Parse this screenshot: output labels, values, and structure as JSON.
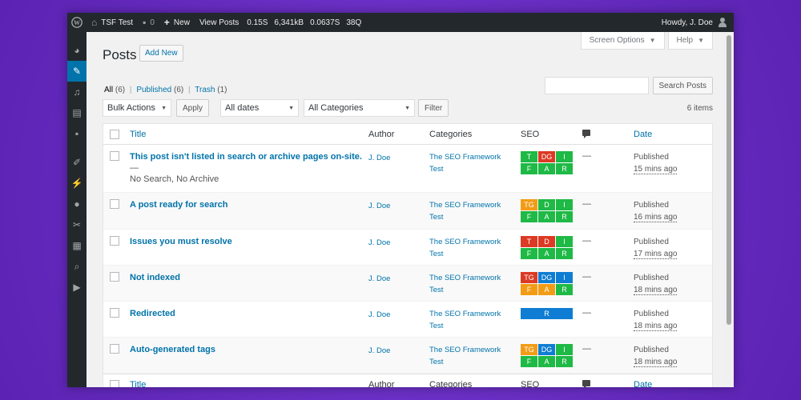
{
  "colors": {
    "seo_green": "#1fb946",
    "seo_red": "#dc3a24",
    "seo_orange": "#f29c16",
    "seo_blue": "#0e7dd3",
    "wp_blue": "#0073aa",
    "admin_bar": "#23282d"
  },
  "adminbar": {
    "site_name": "TSF Test",
    "comments_count": "0",
    "new_label": "New",
    "view_posts": "View Posts",
    "stat_time": "0.15S",
    "stat_memory": "6,341kB",
    "stat_db_time": "0.0637S",
    "stat_queries": "38Q",
    "greeting": "Howdy, J. Doe"
  },
  "sidemenu": {
    "icons": [
      "dashboard-icon",
      "posts-pin-icon",
      "media-icon",
      "pages-icon",
      "comments-icon",
      "appearance-icon",
      "plugins-icon",
      "users-icon",
      "tools-icon",
      "settings-icon",
      "seo-search-icon",
      "play-icon"
    ]
  },
  "screen_meta": {
    "screen_options": "Screen Options",
    "help": "Help"
  },
  "page": {
    "title": "Posts",
    "add_new": "Add New"
  },
  "filters": {
    "all": "All",
    "all_count": "(6)",
    "published": "Published",
    "published_count": "(6)",
    "trash": "Trash",
    "trash_count": "(1)",
    "sep": "|"
  },
  "search": {
    "button": "Search Posts",
    "value": ""
  },
  "tablenav": {
    "bulk_actions": "Bulk Actions",
    "apply": "Apply",
    "dates": "All dates",
    "categories": "All Categories",
    "filter": "Filter",
    "items": "6 items"
  },
  "columns": {
    "title": "Title",
    "author": "Author",
    "categories": "Categories",
    "seo": "SEO",
    "date": "Date"
  },
  "rows": [
    {
      "title": "This post isn't listed in search or archive pages on-site.",
      "state_dash": "—",
      "state": "No Search, No Archive",
      "author": "J. Doe",
      "cat_line1": "The SEO Framework",
      "cat_line2": "Test",
      "comments": "—",
      "date_status": "Published",
      "date_ago": "15 mins ago",
      "seo": [
        [
          "T",
          "red-green:green"
        ],
        [
          "DG",
          "red"
        ],
        [
          "I",
          "green"
        ],
        [
          "F",
          "green"
        ],
        [
          "A",
          "green"
        ],
        [
          "R",
          "green"
        ]
      ]
    },
    {
      "title": "A post ready for search",
      "state_dash": "",
      "state": "",
      "author": "J. Doe",
      "cat_line1": "The SEO Framework",
      "cat_line2": "Test",
      "comments": "—",
      "date_status": "Published",
      "date_ago": "16 mins ago",
      "seo": [
        [
          "TG",
          "orange"
        ],
        [
          "D",
          "green"
        ],
        [
          "I",
          "green"
        ],
        [
          "F",
          "green"
        ],
        [
          "A",
          "green"
        ],
        [
          "R",
          "green"
        ]
      ]
    },
    {
      "title": "Issues you must resolve",
      "state_dash": "",
      "state": "",
      "author": "J. Doe",
      "cat_line1": "The SEO Framework",
      "cat_line2": "Test",
      "comments": "—",
      "date_status": "Published",
      "date_ago": "17 mins ago",
      "seo": [
        [
          "T",
          "red"
        ],
        [
          "D",
          "red"
        ],
        [
          "I",
          "green"
        ],
        [
          "F",
          "green"
        ],
        [
          "A",
          "green"
        ],
        [
          "R",
          "green"
        ]
      ]
    },
    {
      "title": "Not indexed",
      "state_dash": "",
      "state": "",
      "author": "J. Doe",
      "cat_line1": "The SEO Framework",
      "cat_line2": "Test",
      "comments": "—",
      "date_status": "Published",
      "date_ago": "18 mins ago",
      "seo": [
        [
          "TG",
          "red"
        ],
        [
          "DG",
          "blue"
        ],
        [
          "I",
          "blue"
        ],
        [
          "F",
          "orange"
        ],
        [
          "A",
          "orange"
        ],
        [
          "R",
          "green"
        ]
      ]
    },
    {
      "title": "Redirected",
      "state_dash": "",
      "state": "",
      "author": "J. Doe",
      "cat_line1": "The SEO Framework",
      "cat_line2": "Test",
      "comments": "—",
      "date_status": "Published",
      "date_ago": "18 mins ago",
      "seo_wide": "R"
    },
    {
      "title": "Auto-generated tags",
      "state_dash": "",
      "state": "",
      "author": "J. Doe",
      "cat_line1": "The SEO Framework",
      "cat_line2": "Test",
      "comments": "—",
      "date_status": "Published",
      "date_ago": "18 mins ago",
      "seo": [
        [
          "TG",
          "orange"
        ],
        [
          "DG",
          "blue"
        ],
        [
          "I",
          "green"
        ],
        [
          "F",
          "green"
        ],
        [
          "A",
          "green"
        ],
        [
          "R",
          "green"
        ]
      ]
    }
  ]
}
